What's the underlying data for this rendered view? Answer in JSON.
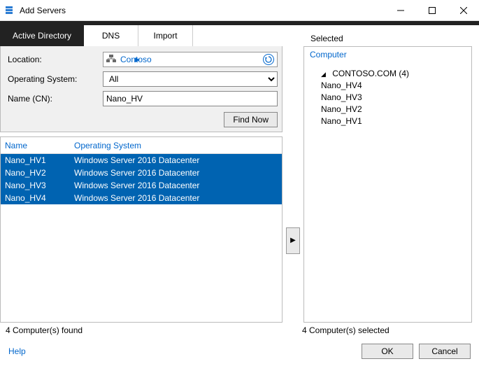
{
  "window": {
    "title": "Add Servers"
  },
  "tabs": {
    "active": "Active Directory",
    "dns": "DNS",
    "import": "Import"
  },
  "form": {
    "location_label": "Location:",
    "location_value": "Contoso",
    "os_label": "Operating System:",
    "os_value": "All",
    "name_label": "Name (CN):",
    "name_value": "Nano_HV",
    "find_now": "Find Now"
  },
  "results": {
    "col_name": "Name",
    "col_os": "Operating System",
    "rows": [
      {
        "name": "Nano_HV1",
        "os": "Windows Server 2016 Datacenter"
      },
      {
        "name": "Nano_HV2",
        "os": "Windows Server 2016 Datacenter"
      },
      {
        "name": "Nano_HV3",
        "os": "Windows Server 2016 Datacenter"
      },
      {
        "name": "Nano_HV4",
        "os": "Windows Server 2016 Datacenter"
      }
    ],
    "status": "4 Computer(s) found"
  },
  "selected": {
    "label": "Selected",
    "header": "Computer",
    "domain": "CONTOSO.COM (4)",
    "items": [
      "Nano_HV4",
      "Nano_HV3",
      "Nano_HV2",
      "Nano_HV1"
    ],
    "status": "4 Computer(s) selected"
  },
  "footer": {
    "help": "Help",
    "ok": "OK",
    "cancel": "Cancel"
  },
  "icons": {
    "arrow_right": "▶",
    "domain_tri": "◢",
    "loc_arrow": "▶"
  }
}
